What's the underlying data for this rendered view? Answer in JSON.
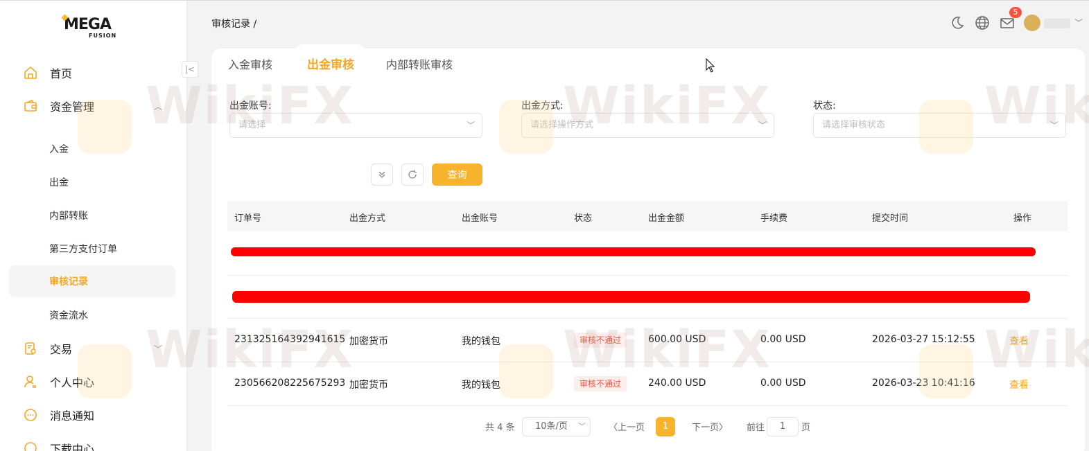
{
  "brand": {
    "logo_main": "MEGA",
    "logo_sub": "FUSION"
  },
  "breadcrumb": "审核记录 /",
  "header": {
    "mail_badge": "5"
  },
  "sidebar": {
    "home": "首页",
    "funds": "资金管理",
    "sub": [
      "入金",
      "出金",
      "内部转账",
      "第三方支付订单",
      "审核记录",
      "资金流水"
    ],
    "trade": "交易",
    "personal": "个人中心",
    "messages": "消息通知",
    "download": "下载中心"
  },
  "tabs": [
    "入金审核",
    "出金审核",
    "内部转账审核"
  ],
  "filters": {
    "account_label": "出金账号:",
    "account_placeholder": "请选择",
    "method_label": "出金方式:",
    "method_placeholder": "请选择操作方式",
    "status_label": "状态:",
    "status_placeholder": "请选择审核状态",
    "query": "查询"
  },
  "table": {
    "headers": [
      "订单号",
      "出金方式",
      "出金账号",
      "状态",
      "出金金额",
      "手续费",
      "提交时间",
      "操作"
    ],
    "rows": [
      {
        "order": "231325164392941615",
        "method": "加密货币",
        "account": "我的钱包",
        "status": "审核不通过",
        "amount": "600.00 USD",
        "fee": "0.00 USD",
        "time": "2026-03-27 15:12:55",
        "action": "查看"
      },
      {
        "order": "230566208225675293",
        "method": "加密货币",
        "account": "我的钱包",
        "status": "审核不通过",
        "amount": "240.00 USD",
        "fee": "0.00 USD",
        "time": "2026-03-23 10:41:16",
        "action": "查看"
      }
    ]
  },
  "pagination": {
    "total": "共 4 条",
    "page_size": "10条/页",
    "prev": "〈上一页",
    "current": "1",
    "next": "下一页〉",
    "goto": "前往",
    "goto_value": "1",
    "page_unit": "页"
  },
  "watermark": "WikiFX",
  "colors": {
    "accent": "#f7b32b",
    "danger": "#e9573f"
  }
}
